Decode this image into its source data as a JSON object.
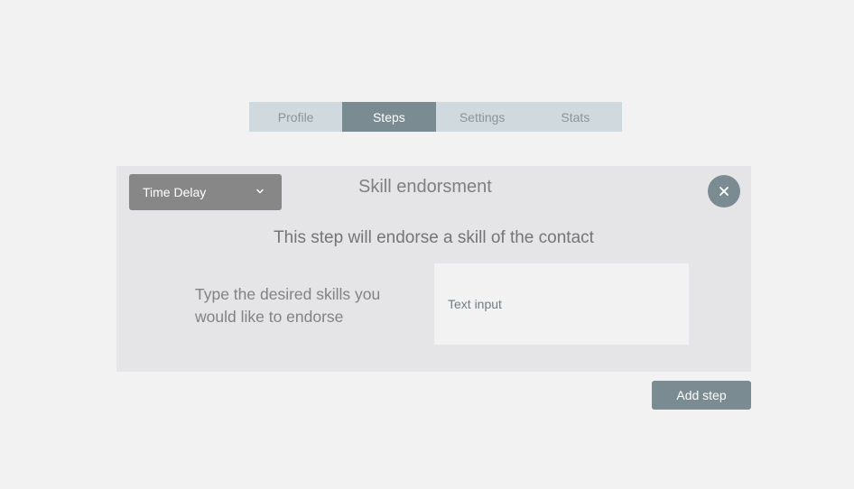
{
  "tabs": [
    {
      "label": "Profile",
      "active": false
    },
    {
      "label": "Steps",
      "active": true
    },
    {
      "label": "Settings",
      "active": false
    },
    {
      "label": "Stats",
      "active": false
    }
  ],
  "step": {
    "type_dropdown": {
      "selected": "Time Delay",
      "icon": "chevron-down-icon"
    },
    "title": "Skill endorsment",
    "close_icon": "close-icon",
    "description": "This step will endorse a skill of the contact",
    "prompt": "Type the desired skills you would like to endorse",
    "input": {
      "placeholder": "Text input",
      "value": ""
    }
  },
  "add_step_label": "Add step",
  "colors": {
    "background": "#f2f2f2",
    "tab_inactive": "#d0d9de",
    "tab_active": "#7a8b92",
    "card": "#e5e5e7",
    "dropdown": "#878787",
    "accent": "#7a8b92"
  }
}
